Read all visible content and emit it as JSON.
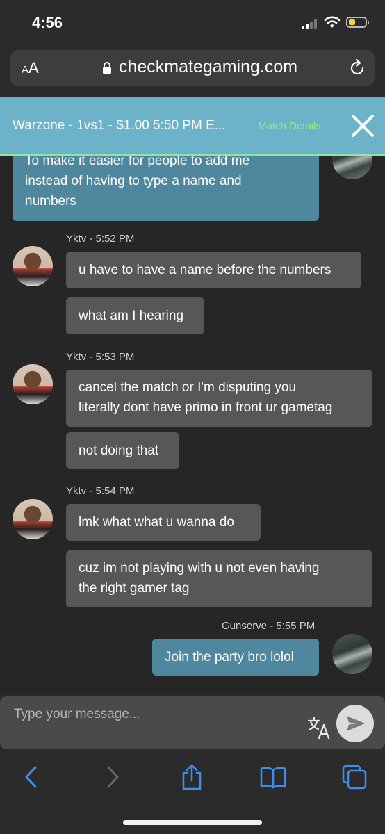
{
  "status": {
    "time": "4:56",
    "battery_color": "#f7d23a"
  },
  "browser": {
    "text_size_label_small": "A",
    "text_size_label_large": "A",
    "url": "checkmategaming.com"
  },
  "banner": {
    "title": "Warzone - 1vs1 - $1.00   5:50 PM E...",
    "link": "Match Details",
    "bg_color": "#6cb2c8",
    "link_color": "#8ff08f"
  },
  "messages": {
    "m0": {
      "lines": [
        "To make it easier for people to add me",
        "instead of having to type a name and",
        "numbers"
      ]
    },
    "g1": {
      "meta": "Yktv - 5:52 PM"
    },
    "m1": {
      "text": "u have to have a name before the numbers"
    },
    "m2": {
      "text": "what am I hearing"
    },
    "g2": {
      "meta": "Yktv - 5:53 PM"
    },
    "m3": {
      "lines": [
        "cancel the match or I'm disputing you",
        "literally dont have primo in front ur gametag"
      ]
    },
    "m4": {
      "text": "not doing that"
    },
    "g3": {
      "meta": "Yktv - 5:54 PM"
    },
    "m5": {
      "text": "lmk what what u wanna do"
    },
    "m6": {
      "lines": [
        "cuz im not playing with u not even having",
        "the right gamer tag"
      ]
    },
    "g4": {
      "meta": "Gunserve - 5:55 PM"
    },
    "m7": {
      "text": "Join the party bro lolol"
    }
  },
  "composer": {
    "placeholder": "Type your message..."
  },
  "colors": {
    "mine_bubble": "#4f889e",
    "theirs_bubble": "#575757",
    "toolbar_icon": "#3d8ef0"
  },
  "icons": [
    "lock-icon",
    "reload-icon",
    "close-icon",
    "translate-icon",
    "send-icon",
    "back-icon",
    "forward-icon",
    "share-icon",
    "bookmarks-icon",
    "tabs-icon"
  ]
}
